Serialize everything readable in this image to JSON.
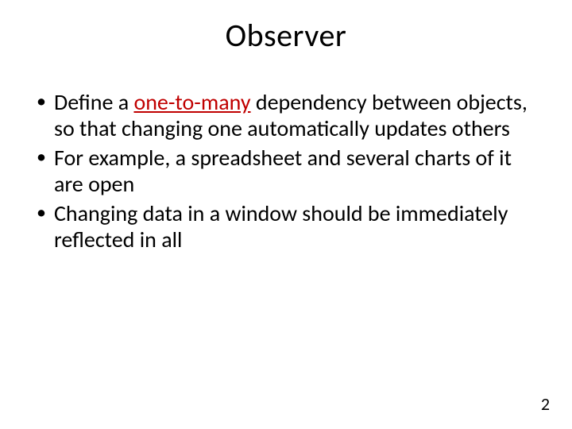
{
  "title": "Observer",
  "bullets": [
    {
      "pre": "Define a ",
      "highlight": "one-to-many",
      "post": " dependency between objects, so that changing one automatically updates others"
    },
    {
      "pre": "For example, a spreadsheet and several charts of it are open",
      "highlight": "",
      "post": ""
    },
    {
      "pre": "Changing data in a window should be immediately reflected in all",
      "highlight": "",
      "post": ""
    }
  ],
  "page_number": "2"
}
